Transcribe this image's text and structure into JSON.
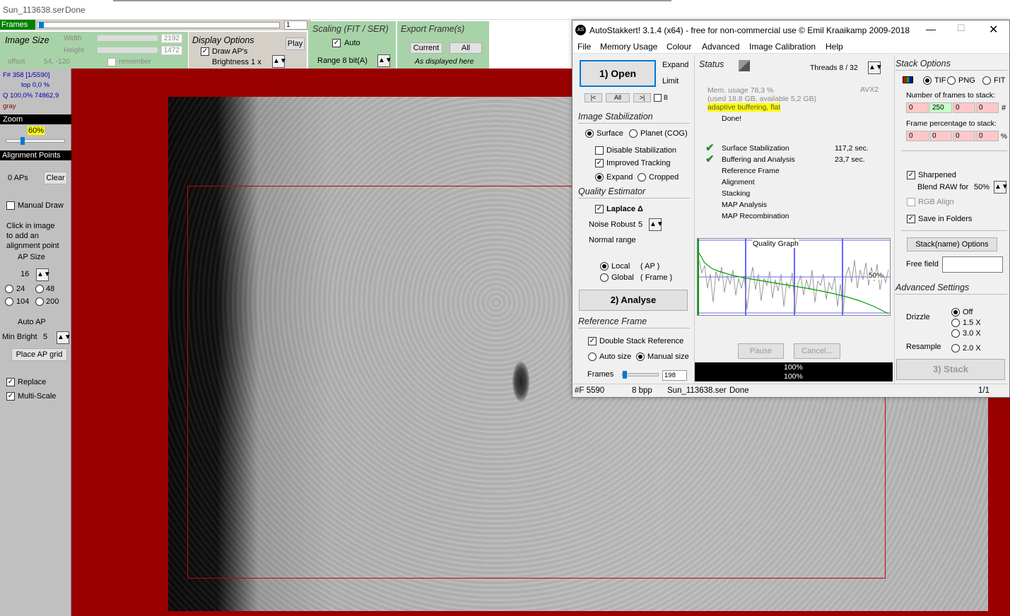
{
  "titlebar": {
    "file": "Sun_113638.ser",
    "status": "Done"
  },
  "frames_bar": {
    "label": "Frames",
    "value": "1"
  },
  "image_size": {
    "title": "Image Size",
    "width_label": "Width",
    "width": "2192",
    "height_label": "Height",
    "height": "1472",
    "offset_label": "offset",
    "offset": "54, -120",
    "remember": "remember"
  },
  "display_options": {
    "title": "Display Options",
    "draw_aps": "Draw AP's",
    "brightness": "Brightness  1 x",
    "play": "Play"
  },
  "scaling": {
    "title": "Scaling (FIT / SER)",
    "auto": "Auto",
    "range": "Range 8 bit(A)"
  },
  "export": {
    "title": "Export Frame(s)",
    "current": "Current",
    "all": "All",
    "displayed": "As displayed here"
  },
  "left": {
    "frame_info": "F# 358 [1/5590]",
    "top": "top 0,0 %",
    "q": "Q 100,0%  74862,9",
    "gray": "gray",
    "zoom_label": "Zoom",
    "zoom_value": "60%",
    "ap_label": "Alignment Points",
    "aps": "0 APs",
    "clear": "Clear",
    "manual_draw": "Manual Draw",
    "hint1": "Click in image",
    "hint2": "to add an",
    "hint3": "alignment point",
    "ap_size_label": "AP Size",
    "ap_size": "16",
    "sizes": [
      "24",
      "48",
      "104",
      "200"
    ],
    "auto_ap": "Auto AP",
    "min_bright_label": "Min Bright",
    "min_bright": "5",
    "place_grid": "Place AP grid",
    "replace": "Replace",
    "multi_scale": "Multi-Scale"
  },
  "dialog": {
    "title": "AutoStakkert! 3.1.4 (x64) - free for non-commercial use © Emil Kraaikamp 2009-2018",
    "menu": [
      "File",
      "Memory Usage",
      "Colour",
      "Advanced",
      "Image Calibration",
      "Help"
    ],
    "open": "1) Open",
    "expand": "Expand",
    "limit": "Limit",
    "nav_prev": "|<",
    "nav_all": "All",
    "nav_next": ">|",
    "nav_b": "B",
    "img_stab": {
      "title": "Image Stabilization",
      "surface": "Surface",
      "planet": "Planet (COG)",
      "disable": "Disable Stabilization",
      "improved": "Improved Tracking",
      "expand": "Expand",
      "cropped": "Cropped"
    },
    "quality": {
      "title": "Quality Estimator",
      "laplace": "Laplace Δ",
      "noise_label": "Noise Robust",
      "noise": "5",
      "normal_range": "Normal range",
      "local": "Local",
      "local_ap": "( AP )",
      "global": "Global",
      "global_frame": "( Frame )"
    },
    "analyse": "2) Analyse",
    "ref": {
      "title": "Reference Frame",
      "double": "Double Stack Reference",
      "auto": "Auto size",
      "manual": "Manual size",
      "frames_label": "Frames",
      "frames": "198"
    },
    "status": {
      "title": "Status",
      "threads": "Threads 8 / 32",
      "mem": "Mem. usage 78,3 %",
      "used": "(used 18,8 GB, available 5,2 GB)",
      "avx": "AVX2",
      "adaptive": "adaptive buffering, flat",
      "done": "Done!",
      "steps": [
        {
          "name": "Surface Stabilization",
          "time": "117,2 sec.",
          "ok": true
        },
        {
          "name": "Buffering and Analysis",
          "time": "23,7 sec.",
          "ok": true
        },
        {
          "name": "Reference Frame",
          "time": "",
          "ok": false
        },
        {
          "name": "Alignment",
          "time": "",
          "ok": false
        },
        {
          "name": "Stacking",
          "time": "",
          "ok": false
        },
        {
          "name": "MAP Analysis",
          "time": "",
          "ok": false
        },
        {
          "name": "MAP Recombination",
          "time": "",
          "ok": false
        }
      ]
    },
    "graph": {
      "title": "Quality Graph",
      "pct": "50%"
    },
    "pause": "Pause",
    "cancel": "Cancel...",
    "prog1": "100%",
    "prog2": "100%",
    "stack": {
      "title": "Stack Options",
      "tif": "TIF",
      "png": "PNG",
      "fit": "FIT",
      "nframes_label": "Number of frames to stack:",
      "nframes": [
        "0",
        "250",
        "0",
        "0"
      ],
      "hash": "#",
      "pct_label": "Frame percentage to stack:",
      "pct": [
        "0",
        "0",
        "0",
        "0"
      ],
      "pct_sym": "%",
      "sharpened": "Sharpened",
      "blend": "Blend RAW for",
      "blend_val": "50%",
      "rgb": "RGB Align",
      "save_folders": "Save in Folders",
      "name_opts": "Stack(name) Options",
      "free_field": "Free field"
    },
    "adv": {
      "title": "Advanced Settings",
      "drizzle": "Drizzle",
      "off": "Off",
      "x15": "1.5 X",
      "x30": "3.0 X",
      "resample": "Resample",
      "x20": "2.0 X"
    },
    "stack_btn": "3) Stack",
    "statusbar": {
      "f": "#F 5590",
      "bpp": "8 bpp",
      "file": "Sun_113638.ser",
      "done": "Done",
      "page": "1/1"
    }
  },
  "colors": {
    "accent": "#008000",
    "frame_red": "#990000",
    "toolbar_green": "#a8d3a8",
    "left_panel": "#c0c0c0",
    "highlight_yellow": "#ffff00"
  }
}
